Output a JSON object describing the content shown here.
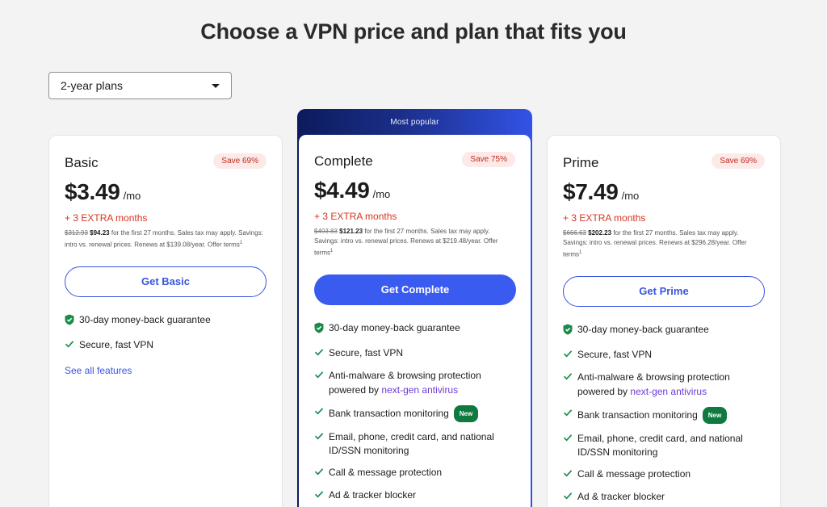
{
  "page": {
    "title": "Choose a VPN price and plan that fits you"
  },
  "plan_select": {
    "value": "2-year plans"
  },
  "popular_label": "Most popular",
  "plans": {
    "basic": {
      "name": "Basic",
      "save": "Save 69%",
      "price": "$3.49",
      "per": "/mo",
      "extra": "+ 3 EXTRA months",
      "old_price": "$312.93",
      "new_price": "$94.23",
      "fine_text": "for the first 27 months. Sales tax may apply. Savings: intro vs. renewal prices. Renews at $139.08/year. Offer terms",
      "fine_sup": "1",
      "cta": "Get Basic",
      "features": [
        "30-day money-back guarantee",
        "Secure, fast VPN"
      ],
      "see_all": "See all features"
    },
    "complete": {
      "name": "Complete",
      "save": "Save 75%",
      "price": "$4.49",
      "per": "/mo",
      "extra": "+ 3 EXTRA months",
      "old_price": "$493.83",
      "new_price": "$121.23",
      "fine_text": "for the first 27 months. Sales tax may apply. Savings: intro vs. renewal prices. Renews at $219.48/year. Offer terms",
      "fine_sup": "1",
      "cta": "Get Complete",
      "features": {
        "f1": "30-day money-back guarantee",
        "f2": "Secure, fast VPN",
        "f3a": "Anti-malware & browsing protection powered by",
        "f3b": "next-gen antivirus",
        "f4": "Bank transaction monitoring",
        "f4_badge": "New",
        "f5": "Email, phone, credit card, and national ID/SSN monitoring",
        "f6": "Call & message protection",
        "f7": "Ad & tracker blocker"
      }
    },
    "prime": {
      "name": "Prime",
      "save": "Save 69%",
      "price": "$7.49",
      "per": "/mo",
      "extra": "+ 3 EXTRA months",
      "old_price": "$666.63",
      "new_price": "$202.23",
      "fine_text": "for the first 27 months. Sales tax may apply. Savings: intro vs. renewal prices. Renews at $296.28/year. Offer terms",
      "fine_sup": "1",
      "cta": "Get Prime",
      "features": {
        "f1": "30-day money-back guarantee",
        "f2": "Secure, fast VPN",
        "f3a": "Anti-malware & browsing protection powered by",
        "f3b": "next-gen antivirus",
        "f4": "Bank transaction monitoring",
        "f4_badge": "New",
        "f5": "Email, phone, credit card, and national ID/SSN monitoring",
        "f6": "Call & message protection",
        "f7": "Ad & tracker blocker"
      }
    }
  },
  "icons": {
    "guarantee": "shield-check-icon",
    "feature": "checkmark-icon",
    "select": "chevron-down-icon"
  },
  "colors": {
    "accent_blue": "#3a55e0",
    "extra_red": "#d8341f",
    "check_green": "#1a8a4a",
    "new_badge": "#0f7a3f",
    "antivirus_purple": "#6c3bd8"
  }
}
